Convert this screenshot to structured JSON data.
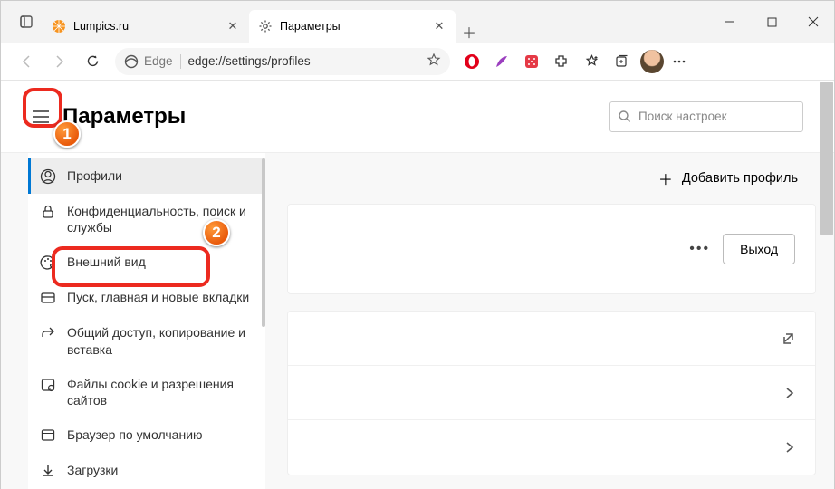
{
  "tabs": [
    {
      "label": "Lumpics.ru"
    },
    {
      "label": "Параметры"
    }
  ],
  "addressBar": {
    "brand": "Edge",
    "url": "edge://settings/profiles"
  },
  "page": {
    "title": "Параметры"
  },
  "search": {
    "placeholder": "Поиск настроек"
  },
  "sidebar": {
    "items": [
      {
        "label": "Профили"
      },
      {
        "label": "Конфиденциальность, поиск и службы"
      },
      {
        "label": "Внешний вид"
      },
      {
        "label": "Пуск, главная и новые вкладки"
      },
      {
        "label": "Общий доступ, копирование и вставка"
      },
      {
        "label": "Файлы cookie и разрешения сайтов"
      },
      {
        "label": "Браузер по умолчанию"
      },
      {
        "label": "Загрузки"
      }
    ]
  },
  "main": {
    "add_profile": "Добавить профиль",
    "sign_out": "Выход"
  },
  "annotations": {
    "num1": "1",
    "num2": "2"
  }
}
